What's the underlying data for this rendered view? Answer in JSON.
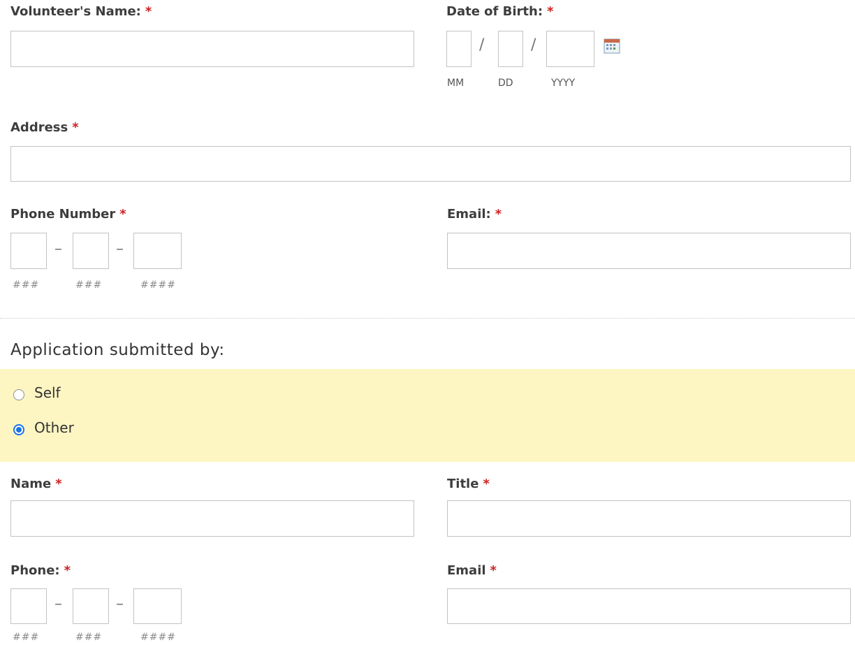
{
  "volunteer_name": {
    "label": "Volunteer's Name:",
    "required": "*",
    "value": ""
  },
  "date_of_birth": {
    "label": "Date of Birth:",
    "required": "*",
    "separator": "/",
    "month_hint": "MM",
    "day_hint": "DD",
    "year_hint": "YYYY",
    "calendar_icon": "calendar-icon"
  },
  "address": {
    "label": "Address",
    "required": "*",
    "value": ""
  },
  "phone_number": {
    "label": "Phone Number",
    "required": "*",
    "separator": "–",
    "hints": [
      "###",
      "###",
      "####"
    ]
  },
  "email": {
    "label": "Email:",
    "required": "*",
    "value": ""
  },
  "submitted_by": {
    "title": "Application submitted by:",
    "options": [
      {
        "label": "Self",
        "selected": false
      },
      {
        "label": "Other",
        "selected": true
      }
    ],
    "highlight_color": "#fdf6c3"
  },
  "other": {
    "name": {
      "label": "Name",
      "required": "*"
    },
    "title": {
      "label": "Title",
      "required": "*"
    },
    "phone": {
      "label": "Phone:",
      "required": "*",
      "separator": "–",
      "hints": [
        "###",
        "###",
        "####"
      ]
    },
    "email": {
      "label": "Email",
      "required": "*"
    }
  },
  "colors": {
    "required": "#cc2222",
    "radio_selected": "#1a73e8",
    "border": "#c3c3c3"
  }
}
